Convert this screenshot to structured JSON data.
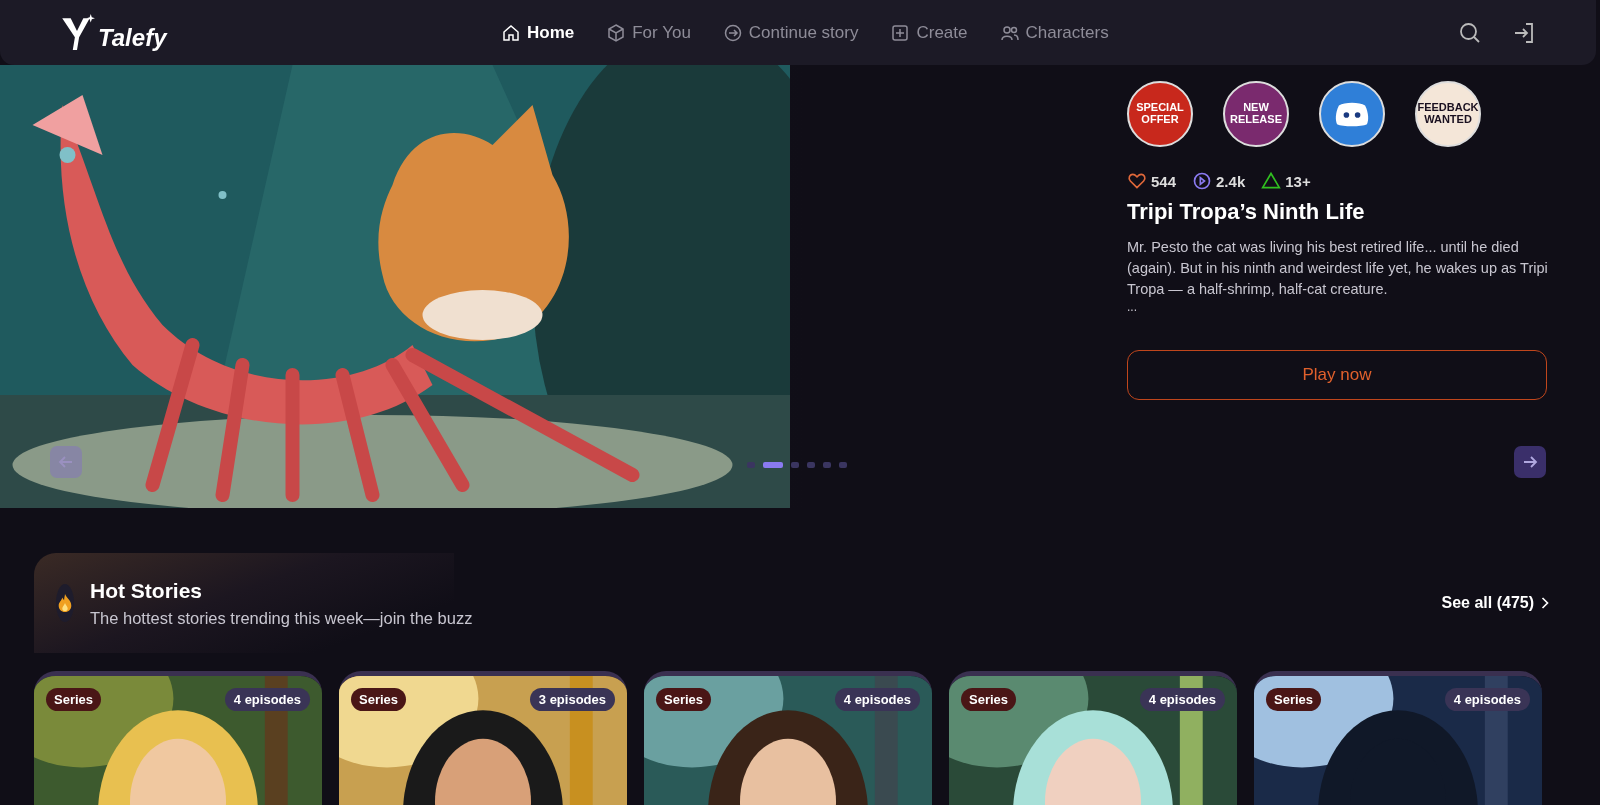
{
  "nav": {
    "logo": "Talefy",
    "items": [
      {
        "label": "Home",
        "selected": true
      },
      {
        "label": "For You",
        "selected": false
      },
      {
        "label": "Continue story",
        "selected": false
      },
      {
        "label": "Create",
        "selected": false
      },
      {
        "label": "Characters",
        "selected": false
      }
    ]
  },
  "hero": {
    "badges": [
      {
        "kind": "text",
        "lines": [
          "SPECIAL",
          "OFFER"
        ],
        "color": "#c8281c"
      },
      {
        "kind": "text",
        "lines": [
          "NEW",
          "RELEASE"
        ],
        "color": "#7a2a6e"
      },
      {
        "kind": "discord",
        "color": "#2f7fd8"
      },
      {
        "kind": "text",
        "lines": [
          "FEEDBACK",
          "WANTED"
        ],
        "color": "#f4e6d8"
      }
    ],
    "stats": {
      "likes": "544",
      "plays": "2.4k",
      "rating": "13+"
    },
    "title": "Tripi Tropa’s Ninth Life",
    "description": "Mr. Pesto the cat was living his best retired life... until he died (again). But in his ninth and weirdest life yet, he wakes up as Tripi Tropa — a half-shrimp, half-cat creature.",
    "more": "...",
    "button": "Play now",
    "slides": [
      {
        "selected": false
      },
      {
        "selected": true
      },
      {
        "selected": false
      },
      {
        "selected": false
      },
      {
        "selected": false
      },
      {
        "selected": false
      }
    ]
  },
  "section": {
    "title": "Hot Stories",
    "subtitle": "The hottest stories trending this week—join the buzz",
    "see_all": "See all (475)",
    "stories": [
      {
        "tag": "Series",
        "episodes": "4 episodes"
      },
      {
        "tag": "Series",
        "episodes": "3 episodes"
      },
      {
        "tag": "Series",
        "episodes": "4 episodes"
      },
      {
        "tag": "Series",
        "episodes": "4 episodes"
      },
      {
        "tag": "Series",
        "episodes": "4 episodes"
      }
    ]
  }
}
